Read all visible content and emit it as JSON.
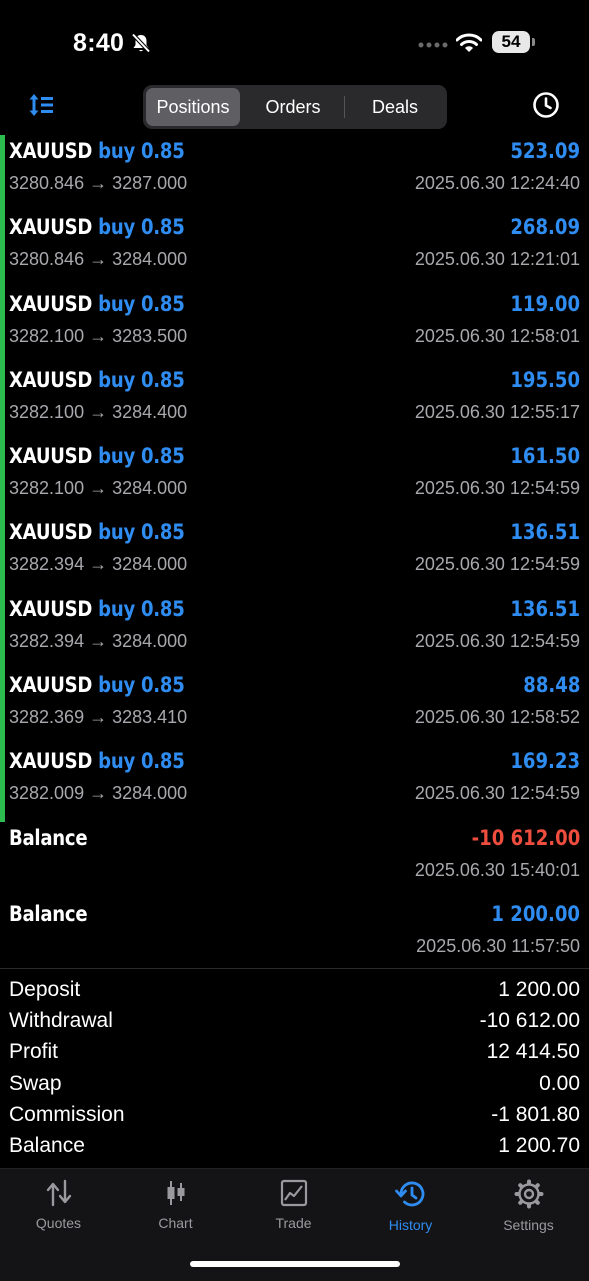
{
  "status_bar": {
    "time": "8:40",
    "battery": "54"
  },
  "segments": [
    {
      "label": "Positions",
      "active": true
    },
    {
      "label": "Orders",
      "active": false
    },
    {
      "label": "Deals",
      "active": false
    }
  ],
  "deals": [
    {
      "symbol": "XAUUSD",
      "side": "buy 0.85",
      "profit": "523.09",
      "prices": "3280.846 → 3287.000",
      "time": "2025.06.30 12:24:40"
    },
    {
      "symbol": "XAUUSD",
      "side": "buy 0.85",
      "profit": "268.09",
      "prices": "3280.846 → 3284.000",
      "time": "2025.06.30 12:21:01"
    },
    {
      "symbol": "XAUUSD",
      "side": "buy 0.85",
      "profit": "119.00",
      "prices": "3282.100 → 3283.500",
      "time": "2025.06.30 12:58:01"
    },
    {
      "symbol": "XAUUSD",
      "side": "buy 0.85",
      "profit": "195.50",
      "prices": "3282.100 → 3284.400",
      "time": "2025.06.30 12:55:17"
    },
    {
      "symbol": "XAUUSD",
      "side": "buy 0.85",
      "profit": "161.50",
      "prices": "3282.100 → 3284.000",
      "time": "2025.06.30 12:54:59"
    },
    {
      "symbol": "XAUUSD",
      "side": "buy 0.85",
      "profit": "136.51",
      "prices": "3282.394 → 3284.000",
      "time": "2025.06.30 12:54:59"
    },
    {
      "symbol": "XAUUSD",
      "side": "buy 0.85",
      "profit": "136.51",
      "prices": "3282.394 → 3284.000",
      "time": "2025.06.30 12:54:59"
    },
    {
      "symbol": "XAUUSD",
      "side": "buy 0.85",
      "profit": "88.48",
      "prices": "3282.369 → 3283.410",
      "time": "2025.06.30 12:58:52"
    },
    {
      "symbol": "XAUUSD",
      "side": "buy 0.85",
      "profit": "169.23",
      "prices": "3282.009 → 3284.000",
      "time": "2025.06.30 12:54:59"
    }
  ],
  "balance_ops": [
    {
      "label": "Balance",
      "amount": "-10 612.00",
      "time": "2025.06.30 15:40:01"
    },
    {
      "label": "Balance",
      "amount": "1 200.00",
      "time": "2025.06.30 11:57:50"
    }
  ],
  "summary": [
    {
      "label": "Deposit",
      "value": "1 200.00"
    },
    {
      "label": "Withdrawal",
      "value": "-10 612.00"
    },
    {
      "label": "Profit",
      "value": "12 414.50"
    },
    {
      "label": "Swap",
      "value": "0.00"
    },
    {
      "label": "Commission",
      "value": "-1 801.80"
    },
    {
      "label": "Balance",
      "value": "1 200.70"
    }
  ],
  "tabs": [
    {
      "label": "Quotes",
      "icon": "quotes-icon"
    },
    {
      "label": "Chart",
      "icon": "chart-icon"
    },
    {
      "label": "Trade",
      "icon": "trade-icon"
    },
    {
      "label": "History",
      "icon": "history-icon"
    },
    {
      "label": "Settings",
      "icon": "settings-icon"
    }
  ],
  "colors": {
    "accent": "#2f8cf0",
    "negative": "#ef4e3f",
    "position_bar": "#2dbd4e"
  }
}
